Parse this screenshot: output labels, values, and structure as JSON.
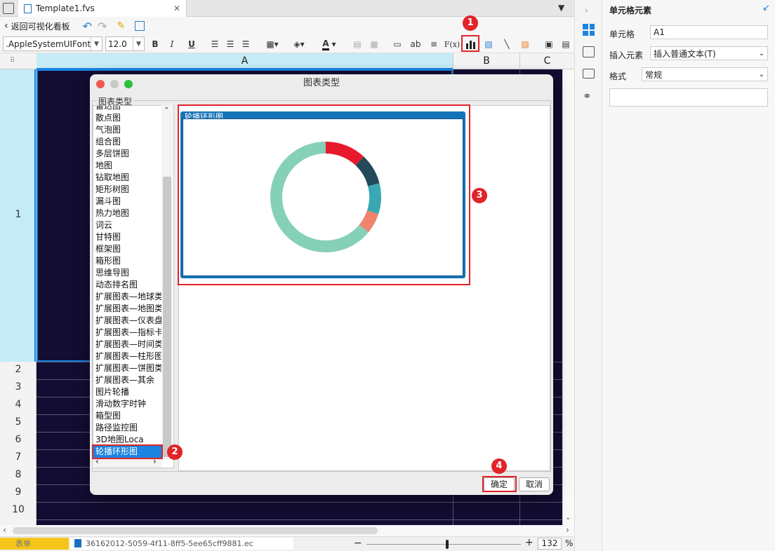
{
  "tab": {
    "filename": "Template1.fvs"
  },
  "toolbar": {
    "back_label": "返回可视化看板",
    "font_name": ".AppleSystemUIFont",
    "font_size": "12.0",
    "bold": "B",
    "italic": "I",
    "underline": "U",
    "abc": "ab",
    "formula": "F(x)"
  },
  "grid": {
    "columns": [
      "A",
      "B",
      "C"
    ],
    "rows": [
      "1",
      "2",
      "3",
      "4",
      "5",
      "6",
      "7",
      "8",
      "9",
      "10"
    ]
  },
  "right_panel": {
    "title": "单元格元素",
    "cell_label": "单元格",
    "cell_value": "A1",
    "insert_label": "插入元素",
    "insert_value": "插入普通文本(T)",
    "format_label": "格式",
    "format_value": "常规"
  },
  "dialog": {
    "title": "图表类型",
    "group_label": "图表类型",
    "items": [
      "雷达图",
      "散点图",
      "气泡图",
      "组合图",
      "多层饼图",
      "地图",
      "钻取地图",
      "矩形树图",
      "漏斗图",
      "热力地图",
      "词云",
      "甘特图",
      "框架图",
      "箱形图",
      "思维导图",
      "动态排名图",
      "扩展图表—地球类",
      "扩展图表—地图类",
      "扩展图表—仪表盘",
      "扩展图表—指标卡",
      "扩展图表—时间类",
      "扩展图表—柱形图",
      "扩展图表—饼图类",
      "扩展图表—其余",
      "图片轮播",
      "滑动数字时钟",
      "箱型图",
      "路径监控图",
      "3D地图Loca",
      "轮播环形图"
    ],
    "selected": "轮播环形图",
    "preview_label": "轮播环形图",
    "ok_label": "确定",
    "cancel_label": "取消"
  },
  "chart_data": {
    "type": "pie",
    "title": "",
    "donut": true,
    "slices": [
      {
        "value": 12,
        "color": "#e8192c"
      },
      {
        "value": 9,
        "color": "#244a5a"
      },
      {
        "value": 9,
        "color": "#3aa8b2"
      },
      {
        "value": 6,
        "color": "#f0836c"
      },
      {
        "value": 64,
        "color": "#85d0b8"
      }
    ]
  },
  "annotations": [
    "1",
    "2",
    "3",
    "4"
  ],
  "statusbar": {
    "sheet_label": "表单",
    "file_id": "36162012-5059-4f11-8ff5-5ee65cff9881.ec",
    "zoom": "132",
    "zoom_unit": "%"
  },
  "colors": {
    "accent": "#1a84e0",
    "annotation": "#e0242a",
    "grid_bg": "#130d33",
    "selected_col": "#c5ecf6"
  }
}
